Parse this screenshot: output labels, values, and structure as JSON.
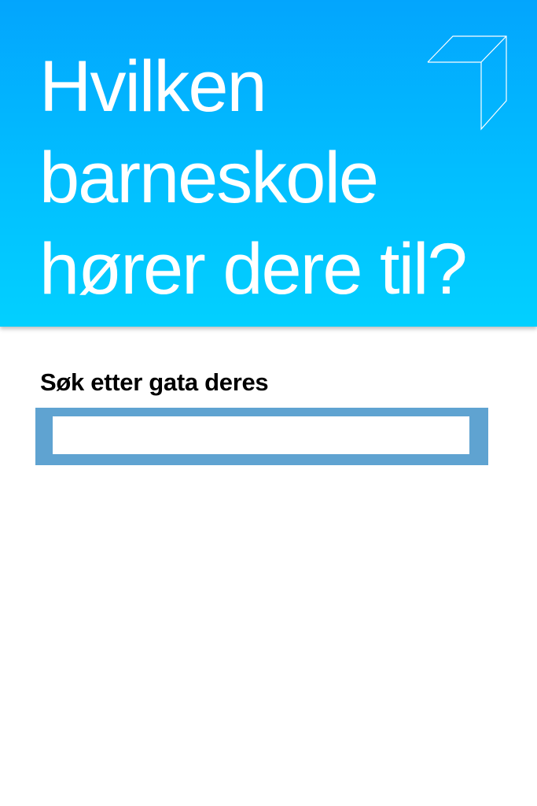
{
  "header": {
    "title_lines": [
      "Hvilken",
      "barneskole",
      "hører dere til?"
    ],
    "logo_icon": "outline-cube-logo-icon",
    "background_colors": [
      "#03a5fd",
      "#02d0ff"
    ]
  },
  "search": {
    "label": "Søk etter gata deres",
    "value": "",
    "placeholder": "",
    "box_color": "#5fa3d1"
  }
}
